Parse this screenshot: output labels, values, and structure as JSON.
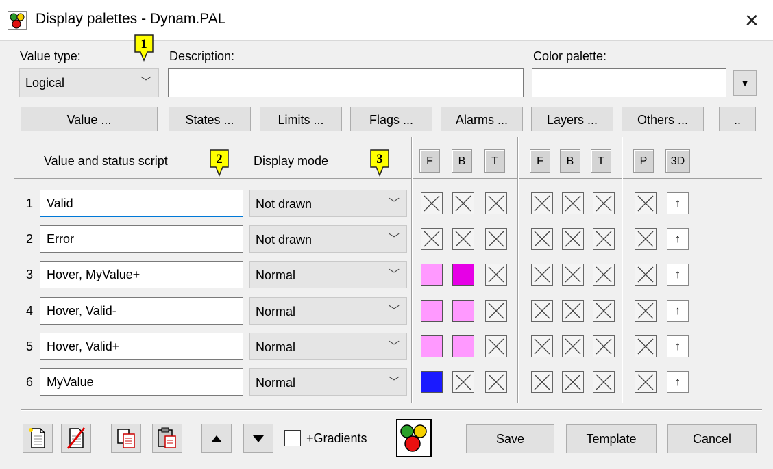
{
  "window": {
    "title": "Display palettes - Dynam.PAL",
    "close_glyph": "✕"
  },
  "top": {
    "value_type_label": "Value type:",
    "value_type_value": "Logical",
    "description_label": "Description:",
    "description_value": "",
    "color_palette_label": "Color palette:",
    "color_palette_value": ""
  },
  "callouts": [
    "1",
    "2",
    "3"
  ],
  "tabs": [
    "Value ...",
    "States ...",
    "Limits ...",
    "Flags ...",
    "Alarms ...",
    "Layers ...",
    "Others ...",
    ".."
  ],
  "grid": {
    "col_script": "Value and status script",
    "col_mode": "Display mode",
    "group_headers": [
      "F",
      "B",
      "T",
      "F",
      "B",
      "T",
      "P",
      "3D"
    ],
    "rows": [
      {
        "num": "1",
        "script": "Valid",
        "mode": "Not drawn",
        "cells": [
          "x",
          "x",
          "x",
          "x",
          "x",
          "x",
          "x"
        ],
        "arrow": "🠅"
      },
      {
        "num": "2",
        "script": "Error",
        "mode": "Not drawn",
        "cells": [
          "x",
          "x",
          "x",
          "x",
          "x",
          "x",
          "x"
        ],
        "arrow": "🠅"
      },
      {
        "num": "3",
        "script": "Hover, MyValue+",
        "mode": "Normal",
        "cells": [
          "#ff99ff",
          "#e600e6",
          "x",
          "x",
          "x",
          "x",
          "x"
        ],
        "arrow": "🠅"
      },
      {
        "num": "4",
        "script": "Hover, Valid-",
        "mode": "Normal",
        "cells": [
          "#ff99ff",
          "#ff99ff",
          "x",
          "x",
          "x",
          "x",
          "x"
        ],
        "arrow": "🠅"
      },
      {
        "num": "5",
        "script": "Hover, Valid+",
        "mode": "Normal",
        "cells": [
          "#ff99ff",
          "#ff99ff",
          "x",
          "x",
          "x",
          "x",
          "x"
        ],
        "arrow": "🠅"
      },
      {
        "num": "6",
        "script": "MyValue",
        "mode": "Normal",
        "cells": [
          "#1a1aff",
          "x",
          "x",
          "x",
          "x",
          "x",
          "x"
        ],
        "arrow": "🠅"
      }
    ]
  },
  "bottom": {
    "icons": [
      "new-document-icon",
      "delete-document-icon",
      "copy-icon",
      "paste-icon",
      "move-up-icon",
      "move-down-icon"
    ],
    "gradients_label": "+Gradients",
    "gradients_checked": false,
    "save_label": "Save",
    "template_label": "Template",
    "cancel_label": "Cancel"
  },
  "colors": {
    "callout_fill": "#ffff00",
    "focus_border": "#0078d7"
  }
}
